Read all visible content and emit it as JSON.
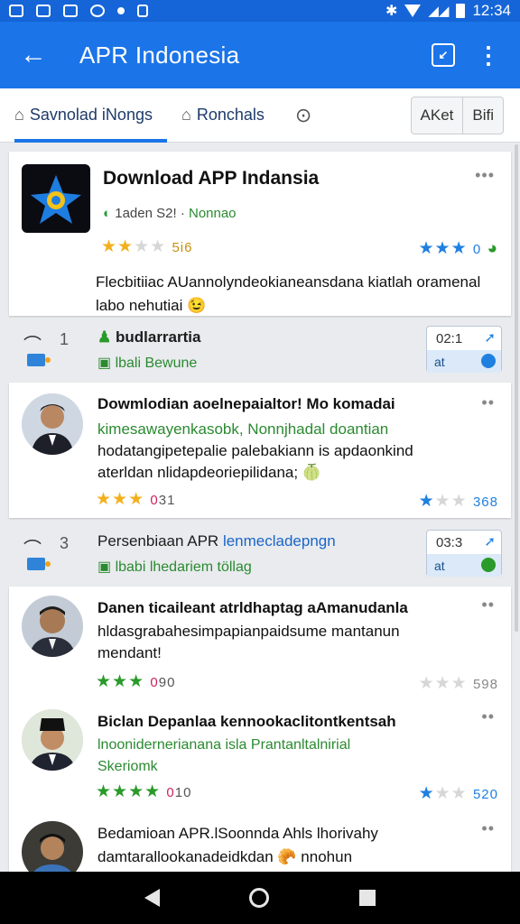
{
  "status_bar": {
    "time": "12:34",
    "icons": [
      "mail-icon",
      "calendar-icon",
      "image-icon",
      "chat-icon",
      "notification-dot",
      "clipboard-icon",
      "bluetooth-icon",
      "wifi-icon",
      "signal-icon",
      "battery-icon"
    ]
  },
  "app_bar": {
    "title": "APR Indonesia",
    "accent": "#1b74e8"
  },
  "tabs": [
    {
      "label": "Savnolad iNongs",
      "active": true,
      "icon": "bag-icon"
    },
    {
      "label": "Ronchals",
      "active": false,
      "icon": "bell-icon"
    }
  ],
  "segment": {
    "left": "AKet",
    "right": "Bifi"
  },
  "app_card": {
    "title": "Download APP Indansia",
    "meta_a": "1aden",
    "meta_b": "S2!",
    "meta_sep": "·",
    "meta_c": "Nonnao",
    "rating_stars": 2.5,
    "rating_text": "5i6",
    "right_rating_stars": 3,
    "right_rating_text": "0",
    "description": "Flecbitiiac AUannolyndeokianeansdana kiatlah oramenal labo nehutiai 😉"
  },
  "section_1": {
    "num": "1",
    "title": "budlarrartia",
    "sub": "lbali Bewune",
    "box_top": "02:1",
    "box_bottom": "at"
  },
  "review_1": {
    "title": "Dowmlodian aoelnepaialtor! Mo komadai",
    "line2": "kimesawayenkasobk, Nonnjhadal doantian",
    "line3": "hodatangipetepalie palebakiann is apdaonkind",
    "line4": "aterldan nlidapdeoriepilidana; 🍈",
    "rating_stars": 3,
    "badge": "0",
    "badge_text": "31",
    "right_stars": 1.5,
    "right_text": "368"
  },
  "section_2": {
    "num": "3",
    "title": "Persenbiaan APR",
    "title_accent": "lenmecladepngn",
    "sub": "lbabi lhedariem töllag",
    "box_top": "03:3",
    "box_bottom": "at"
  },
  "review_2": {
    "title": "Danen ticaileant atrldhaptag aAmanudanla",
    "line2": "hldasgrabahesimpapianpaidsume mantanun",
    "line3": "mendant!",
    "rating_stars": 3,
    "badge": "0",
    "badge_text": "90",
    "right_stars": 0,
    "right_text": "598"
  },
  "review_3": {
    "title": "Biclan Depanlaa kennookaclitontkentsah",
    "line2": "lnoonidernerianana isla Prantanltalnirial",
    "line3": "Skeriomk",
    "rating_stars": 4,
    "badge": "0",
    "badge_text": "10",
    "right_stars": 1,
    "right_text": "520"
  },
  "review_4": {
    "title": "Bedamioan APR.lSoonnda Ahls lhorivahy",
    "line2": "damtarallookanadeidkdan 🥐 nnohun"
  }
}
